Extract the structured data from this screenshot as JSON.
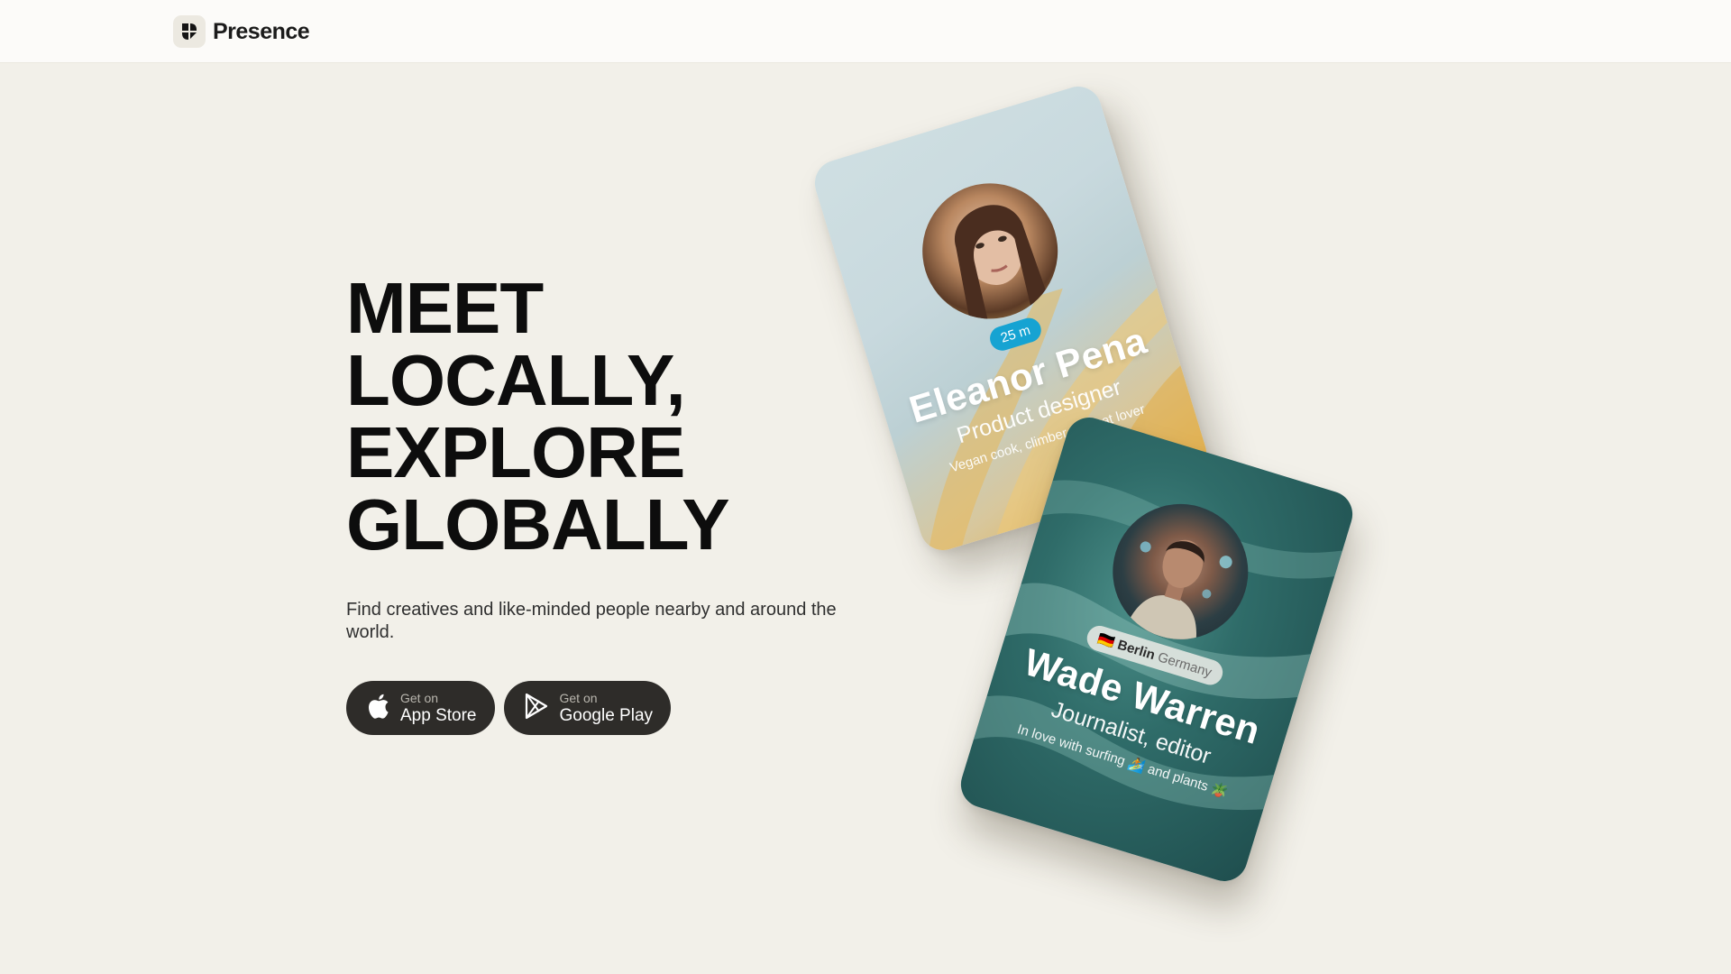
{
  "header": {
    "brand": "Presence"
  },
  "hero": {
    "title_lines": [
      "MEET",
      "LOCALLY,",
      "EXPLORE",
      "GLOBALLY"
    ],
    "subtitle": "Find creatives and like-minded people nearby and around the world."
  },
  "stores": [
    {
      "small": "Get on",
      "big": "App Store",
      "icon": "apple-icon"
    },
    {
      "small": "Get on",
      "big": "Google Play",
      "icon": "google-play-icon"
    }
  ],
  "cards": [
    {
      "badge": "25 m",
      "name": "Eleanor Pena",
      "role": "Product designer",
      "bio": "Vegan cook, climber and cat lover"
    },
    {
      "badge_city": "Berlin",
      "badge_country": "Germany",
      "flag": "🇩🇪",
      "name": "Wade Warren",
      "role": "Journalist, editor",
      "bio": "In love with surfing 🏄 and plants 🪴"
    }
  ],
  "colors": {
    "background": "#f2f0e9",
    "header": "#fcfbf9",
    "button": "#2e2c29",
    "distance_badge": "#16a3d2"
  }
}
